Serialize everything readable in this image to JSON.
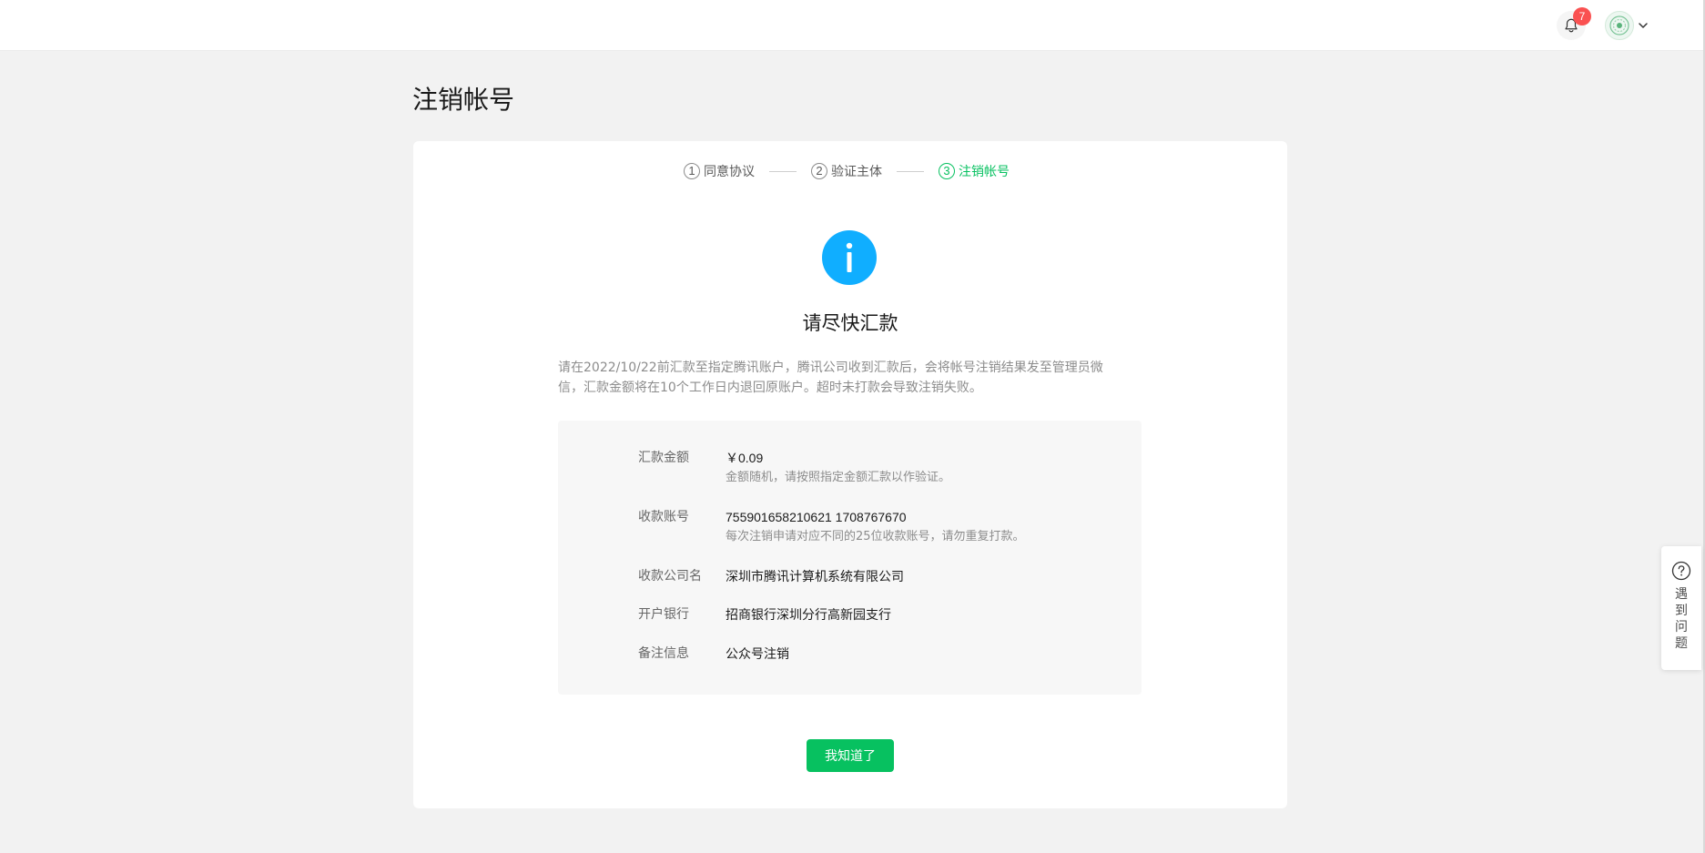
{
  "header": {
    "notification_count": "7",
    "bell_icon": "bell-icon",
    "avatar_icon": "account-avatar",
    "chevron_icon": "chevron-down-icon"
  },
  "page": {
    "title": "注销帐号"
  },
  "steps": [
    {
      "number": "1",
      "label": "同意协议",
      "state": "done"
    },
    {
      "number": "2",
      "label": "验证主体",
      "state": "done"
    },
    {
      "number": "3",
      "label": "注销帐号",
      "state": "active"
    }
  ],
  "notice": {
    "icon": "info-icon",
    "title": "请尽快汇款",
    "description": "请在2022/10/22前汇款至指定腾讯账户，腾讯公司收到汇款后，会将帐号注销结果发至管理员微信，汇款金额将在10个工作日内退回原账户。超时未打款会导致注销失败。"
  },
  "remittance": {
    "amount_label": "汇款金额",
    "amount_value": "￥0.09",
    "amount_note": "金额随机，请按照指定金额汇款以作验证。",
    "account_label": "收款账号",
    "account_value": "755901658210621 1708767670",
    "account_note": "每次注销申请对应不同的25位收款账号，请勿重复打款。",
    "company_label": "收款公司名",
    "company_value": "深圳市腾讯计算机系统有限公司",
    "bank_label": "开户银行",
    "bank_value": "招商银行深圳分行高新园支行",
    "memo_label": "备注信息",
    "memo_value": "公众号注销"
  },
  "actions": {
    "confirm_label": "我知道了"
  },
  "help": {
    "icon": "question-circle-icon",
    "label": "遇到问题"
  },
  "colors": {
    "accent_green": "#07c160",
    "info_blue": "#10aeff",
    "badge_red": "#fa5151",
    "page_bg": "#f2f2f2"
  }
}
